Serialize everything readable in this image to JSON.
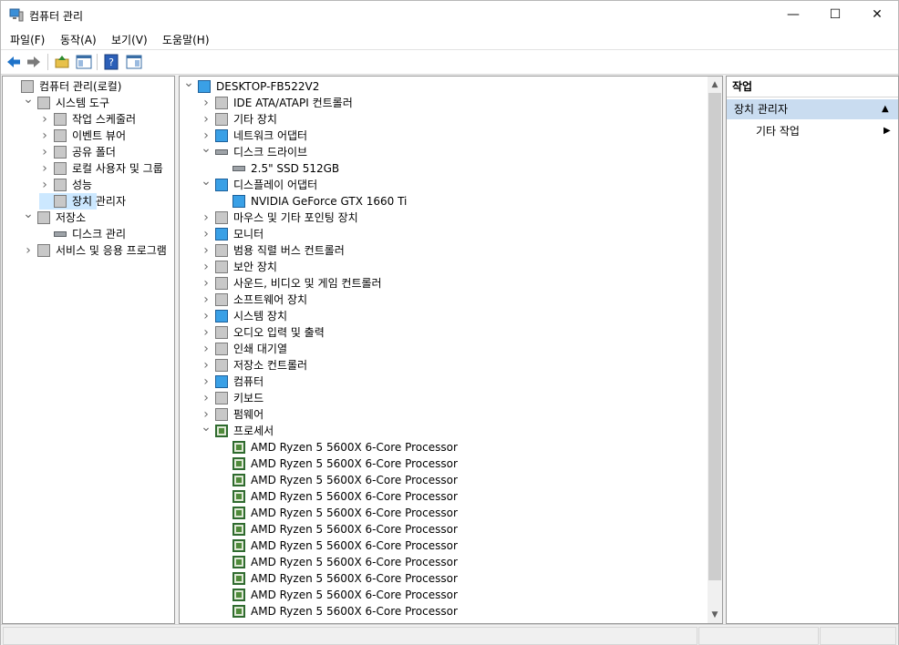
{
  "window": {
    "title": "컴퓨터 관리",
    "minimize": "—",
    "maximize": "☐",
    "close": "✕"
  },
  "menu": [
    "파일(F)",
    "동작(A)",
    "보기(V)",
    "도움말(H)"
  ],
  "left_tree": [
    {
      "label": "컴퓨터 관리(로컬)",
      "level": 0,
      "expander": "",
      "icon": "computer-management-icon"
    },
    {
      "label": "시스템 도구",
      "level": 1,
      "expander": "v",
      "icon": "tools-icon"
    },
    {
      "label": "작업 스케줄러",
      "level": 2,
      "expander": ">",
      "icon": "clock-icon"
    },
    {
      "label": "이벤트 뷰어",
      "level": 2,
      "expander": ">",
      "icon": "event-viewer-icon"
    },
    {
      "label": "공유 폴더",
      "level": 2,
      "expander": ">",
      "icon": "shared-folder-icon"
    },
    {
      "label": "로컬 사용자 및 그룹",
      "level": 2,
      "expander": ">",
      "icon": "users-icon"
    },
    {
      "label": "성능",
      "level": 2,
      "expander": ">",
      "icon": "performance-icon"
    },
    {
      "label": "장치 관리자",
      "level": 2,
      "expander": "",
      "icon": "device-manager-icon",
      "selected": true
    },
    {
      "label": "저장소",
      "level": 1,
      "expander": "v",
      "icon": "storage-icon"
    },
    {
      "label": "디스크 관리",
      "level": 2,
      "expander": "",
      "icon": "disk-management-icon"
    },
    {
      "label": "서비스 및 응용 프로그램",
      "level": 1,
      "expander": ">",
      "icon": "services-icon"
    }
  ],
  "device_tree": [
    {
      "label": "DESKTOP-FB522V2",
      "level": 0,
      "expander": "v",
      "icon": "computer-icon"
    },
    {
      "label": "IDE ATA/ATAPI 컨트롤러",
      "level": 1,
      "expander": ">",
      "icon": "ide-controller-icon"
    },
    {
      "label": "기타 장치",
      "level": 1,
      "expander": ">",
      "icon": "unknown-device-icon"
    },
    {
      "label": "네트워크 어댑터",
      "level": 1,
      "expander": ">",
      "icon": "network-adapter-icon"
    },
    {
      "label": "디스크 드라이브",
      "level": 1,
      "expander": "v",
      "icon": "disk-drive-icon"
    },
    {
      "label": "2.5\" SSD 512GB",
      "level": 2,
      "expander": "",
      "icon": "disk-drive-icon"
    },
    {
      "label": "디스플레이 어댑터",
      "level": 1,
      "expander": "v",
      "icon": "display-adapter-icon"
    },
    {
      "label": "NVIDIA GeForce GTX 1660 Ti",
      "level": 2,
      "expander": "",
      "icon": "display-adapter-icon"
    },
    {
      "label": "마우스 및 기타 포인팅 장치",
      "level": 1,
      "expander": ">",
      "icon": "mouse-icon"
    },
    {
      "label": "모니터",
      "level": 1,
      "expander": ">",
      "icon": "monitor-icon"
    },
    {
      "label": "범용 직렬 버스 컨트롤러",
      "level": 1,
      "expander": ">",
      "icon": "usb-icon"
    },
    {
      "label": "보안 장치",
      "level": 1,
      "expander": ">",
      "icon": "security-device-icon"
    },
    {
      "label": "사운드, 비디오 및 게임 컨트롤러",
      "level": 1,
      "expander": ">",
      "icon": "sound-icon"
    },
    {
      "label": "소프트웨어 장치",
      "level": 1,
      "expander": ">",
      "icon": "software-device-icon"
    },
    {
      "label": "시스템 장치",
      "level": 1,
      "expander": ">",
      "icon": "system-device-icon"
    },
    {
      "label": "오디오 입력 및 출력",
      "level": 1,
      "expander": ">",
      "icon": "audio-icon"
    },
    {
      "label": "인쇄 대기열",
      "level": 1,
      "expander": ">",
      "icon": "printer-icon"
    },
    {
      "label": "저장소 컨트롤러",
      "level": 1,
      "expander": ">",
      "icon": "storage-controller-icon"
    },
    {
      "label": "컴퓨터",
      "level": 1,
      "expander": ">",
      "icon": "computer-icon"
    },
    {
      "label": "키보드",
      "level": 1,
      "expander": ">",
      "icon": "keyboard-icon"
    },
    {
      "label": "펌웨어",
      "level": 1,
      "expander": ">",
      "icon": "firmware-icon"
    },
    {
      "label": "프로세서",
      "level": 1,
      "expander": "v",
      "icon": "processor-icon"
    },
    {
      "label": "AMD Ryzen 5 5600X 6-Core Processor",
      "level": 2,
      "expander": "",
      "icon": "processor-icon"
    },
    {
      "label": "AMD Ryzen 5 5600X 6-Core Processor",
      "level": 2,
      "expander": "",
      "icon": "processor-icon"
    },
    {
      "label": "AMD Ryzen 5 5600X 6-Core Processor",
      "level": 2,
      "expander": "",
      "icon": "processor-icon"
    },
    {
      "label": "AMD Ryzen 5 5600X 6-Core Processor",
      "level": 2,
      "expander": "",
      "icon": "processor-icon"
    },
    {
      "label": "AMD Ryzen 5 5600X 6-Core Processor",
      "level": 2,
      "expander": "",
      "icon": "processor-icon"
    },
    {
      "label": "AMD Ryzen 5 5600X 6-Core Processor",
      "level": 2,
      "expander": "",
      "icon": "processor-icon"
    },
    {
      "label": "AMD Ryzen 5 5600X 6-Core Processor",
      "level": 2,
      "expander": "",
      "icon": "processor-icon"
    },
    {
      "label": "AMD Ryzen 5 5600X 6-Core Processor",
      "level": 2,
      "expander": "",
      "icon": "processor-icon"
    },
    {
      "label": "AMD Ryzen 5 5600X 6-Core Processor",
      "level": 2,
      "expander": "",
      "icon": "processor-icon"
    },
    {
      "label": "AMD Ryzen 5 5600X 6-Core Processor",
      "level": 2,
      "expander": "",
      "icon": "processor-icon"
    },
    {
      "label": "AMD Ryzen 5 5600X 6-Core Processor",
      "level": 2,
      "expander": "",
      "icon": "processor-icon"
    }
  ],
  "actions": {
    "header": "작업",
    "section": "장치 관리자",
    "section_arrow": "▲",
    "item": "기타 작업",
    "item_arrow": "▶"
  },
  "colors": {
    "selection": "#cce8ff",
    "actions_section": "#c9dcf0",
    "processor_icon": "#2f6b2f"
  }
}
